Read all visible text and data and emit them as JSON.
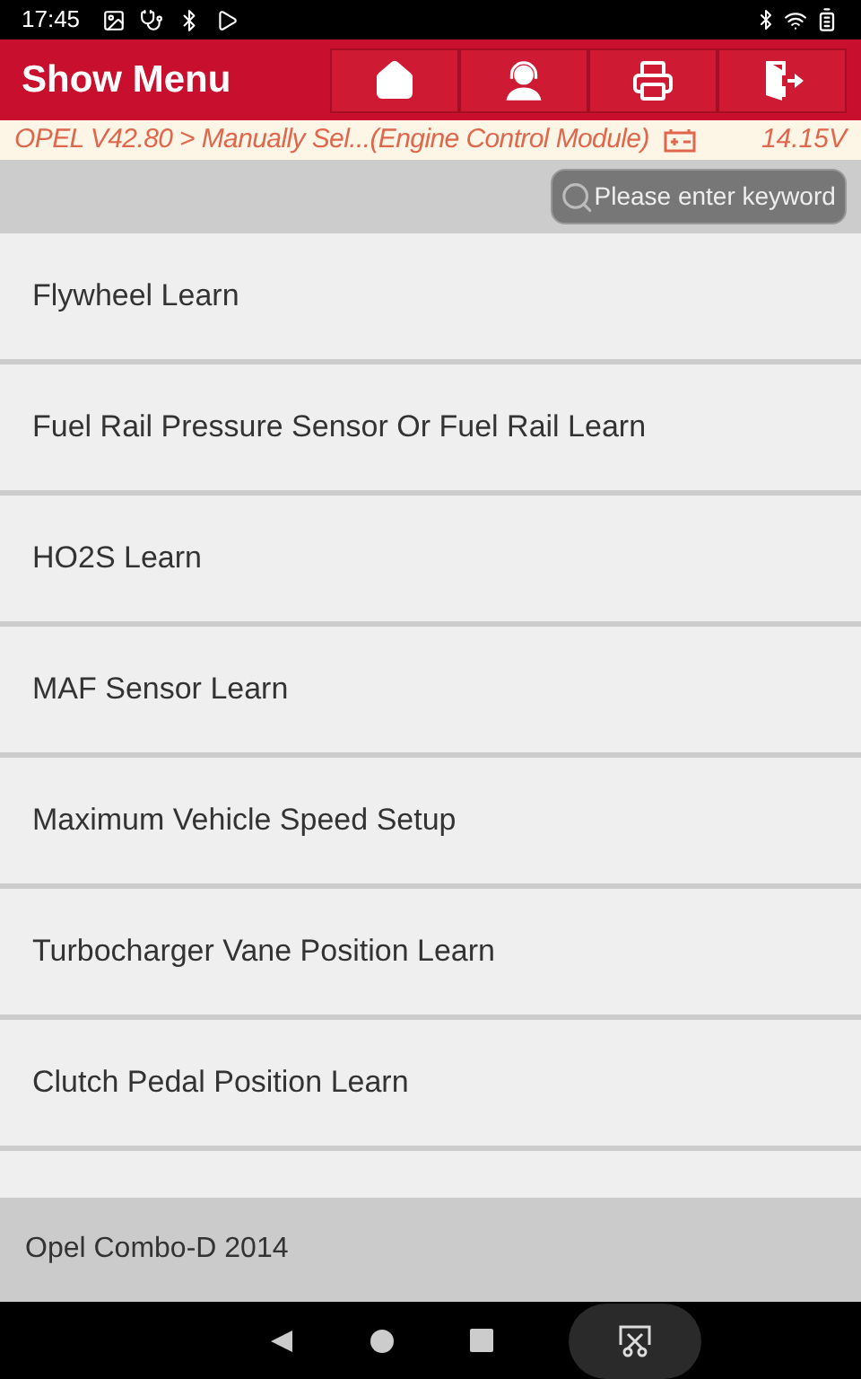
{
  "status_bar": {
    "time": "17:45"
  },
  "header": {
    "title": "Show Menu"
  },
  "breadcrumb": {
    "path": "OPEL V42.80 > Manually Sel...(Engine Control Module)",
    "voltage": "14.15V"
  },
  "search": {
    "placeholder": "Please enter keyword"
  },
  "menu_items": [
    {
      "label": "Flywheel Learn"
    },
    {
      "label": "Fuel Rail Pressure Sensor Or Fuel Rail Learn"
    },
    {
      "label": "HO2S Learn"
    },
    {
      "label": "MAF Sensor Learn"
    },
    {
      "label": "Maximum Vehicle Speed Setup"
    },
    {
      "label": "Turbocharger Vane Position Learn"
    },
    {
      "label": "Clutch Pedal Position Learn"
    }
  ],
  "footer": {
    "vehicle": "Opel Combo-D 2014"
  }
}
